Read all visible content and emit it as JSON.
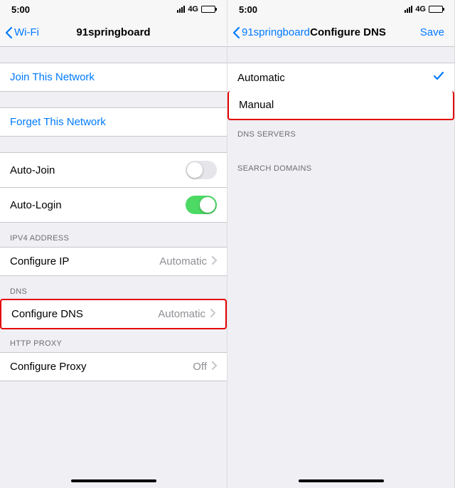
{
  "status": {
    "time": "5:00",
    "network": "4G"
  },
  "left": {
    "back": "Wi-Fi",
    "title": "91springboard",
    "join": "Join This Network",
    "forget": "Forget This Network",
    "autoJoin": {
      "label": "Auto-Join",
      "on": false
    },
    "autoLogin": {
      "label": "Auto-Login",
      "on": true
    },
    "ipv4Header": "IPV4 ADDRESS",
    "configureIp": {
      "label": "Configure IP",
      "value": "Automatic"
    },
    "dnsHeader": "DNS",
    "configureDns": {
      "label": "Configure DNS",
      "value": "Automatic"
    },
    "proxyHeader": "HTTP PROXY",
    "configureProxy": {
      "label": "Configure Proxy",
      "value": "Off"
    }
  },
  "right": {
    "back": "91springboard",
    "title": "Configure DNS",
    "save": "Save",
    "automatic": "Automatic",
    "manual": "Manual",
    "dnsServers": "DNS SERVERS",
    "searchDomains": "SEARCH DOMAINS"
  }
}
